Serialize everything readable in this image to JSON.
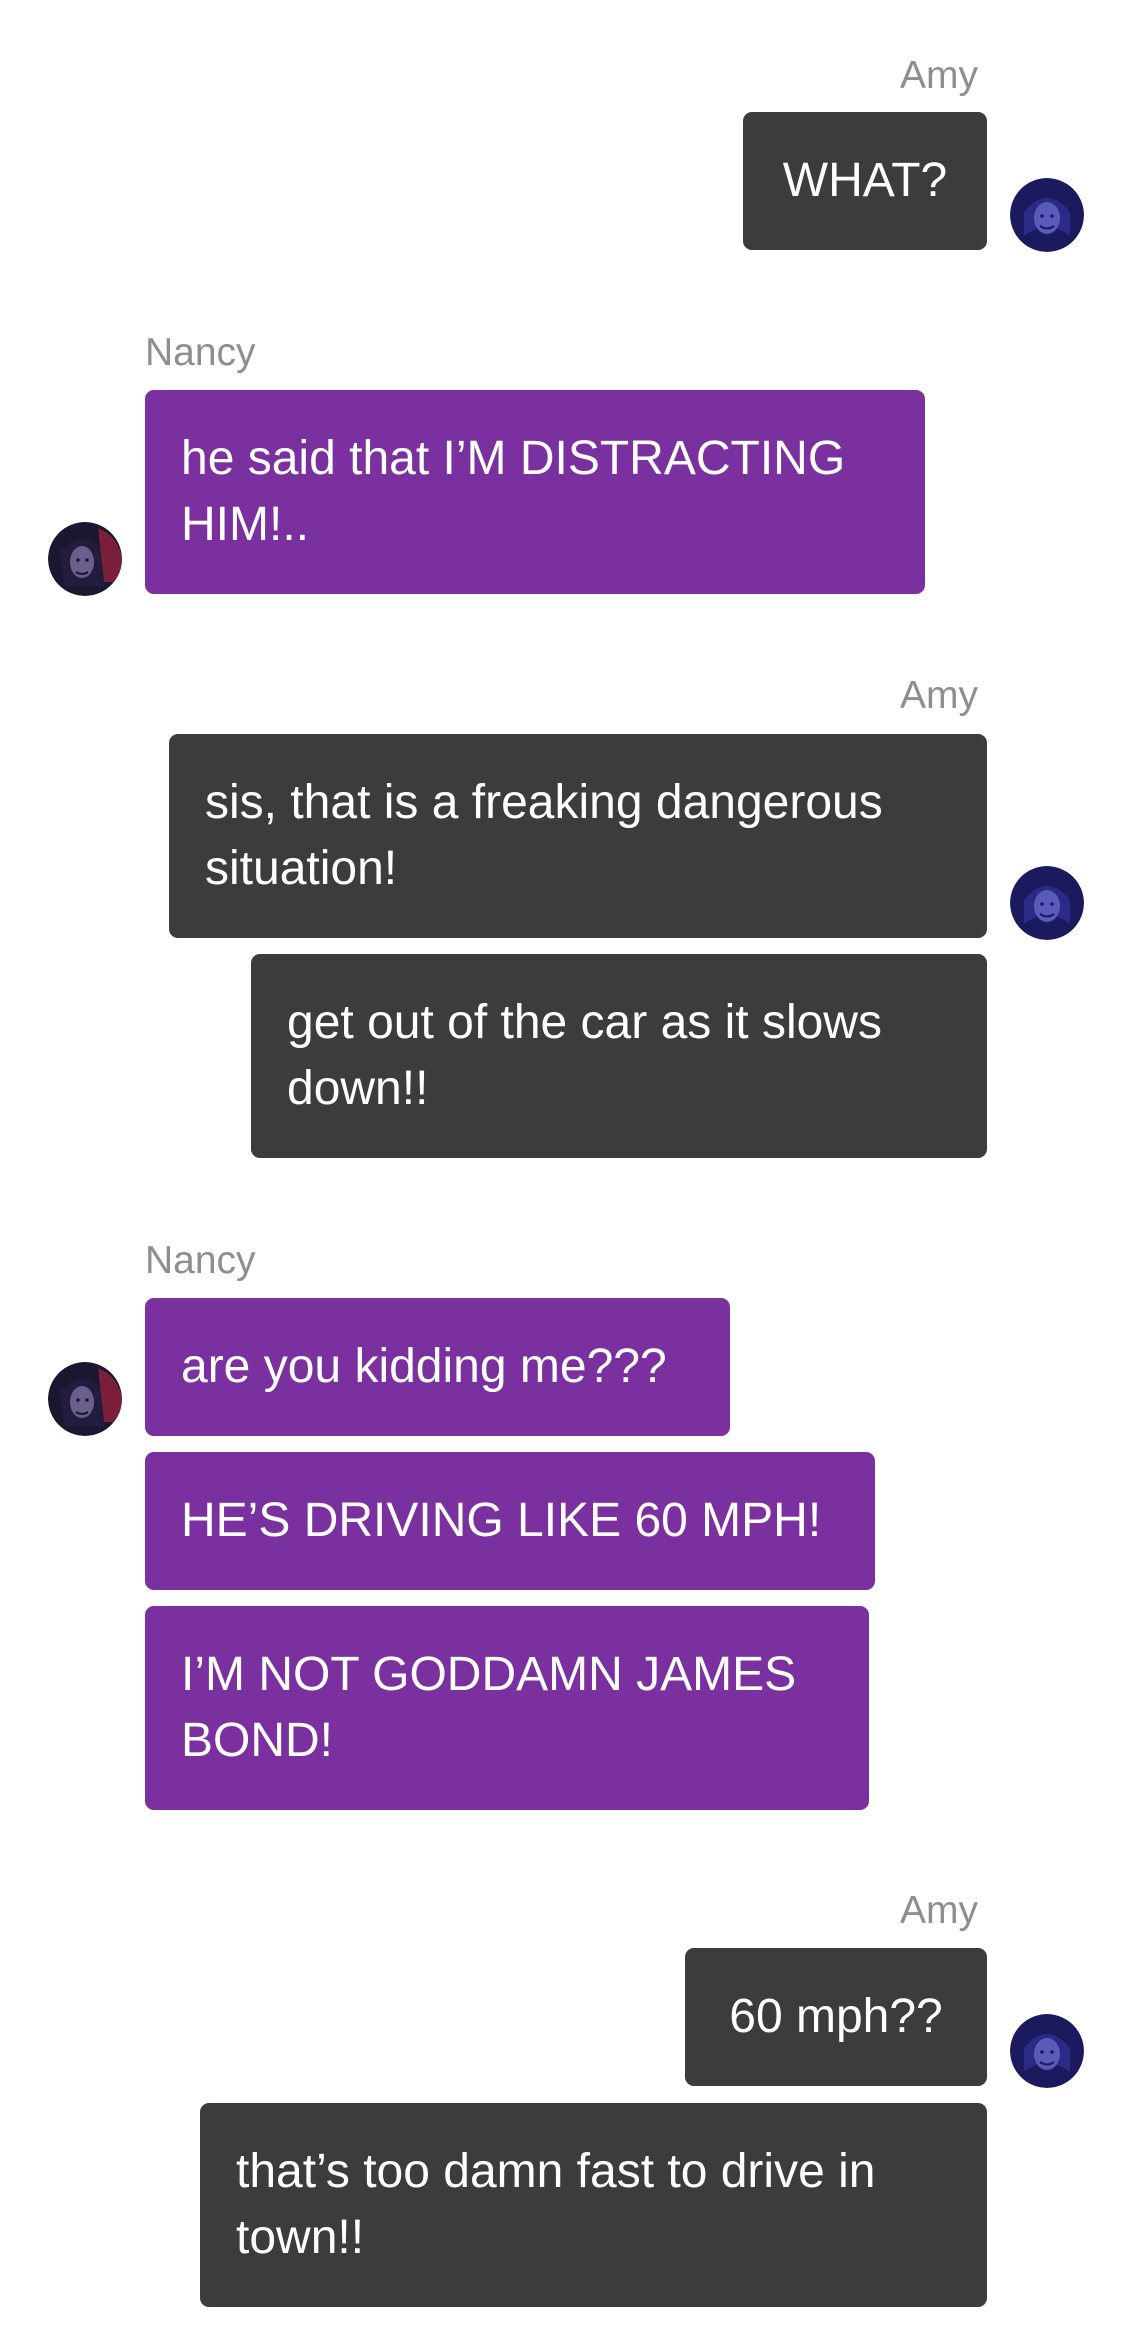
{
  "conversation": {
    "messages": [
      {
        "sender": "Amy",
        "text": "WHAT?"
      },
      {
        "sender": "Nancy",
        "text": "he said that I’M DISTRACTING HIM!.."
      },
      {
        "sender": "Amy",
        "text": "sis, that is a freaking dangerous situation!"
      },
      {
        "sender": "Amy",
        "text": "get out of the car as it slows down!!"
      },
      {
        "sender": "Nancy",
        "text": "are you kidding me???"
      },
      {
        "sender": "Nancy",
        "text": "HE’S DRIVING LIKE 60 MPH!"
      },
      {
        "sender": "Nancy",
        "text": "I’M NOT GODDAMN JAMES BOND!"
      },
      {
        "sender": "Amy",
        "text": "60 mph??"
      },
      {
        "sender": "Amy",
        "text": "that’s too damn fast to drive in town!!"
      }
    ],
    "groups": [
      {
        "sender": "Amy"
      },
      {
        "sender": "Nancy"
      },
      {
        "sender": "Amy"
      },
      {
        "sender": "Nancy"
      },
      {
        "sender": "Amy"
      }
    ]
  },
  "colors": {
    "amy_bubble": "#3c3c3c",
    "nancy_bubble": "#7b30a0",
    "sender_name": "#8e8e8e"
  },
  "avatars": {
    "amy": "amy-avatar-icon",
    "nancy": "nancy-avatar-icon"
  }
}
